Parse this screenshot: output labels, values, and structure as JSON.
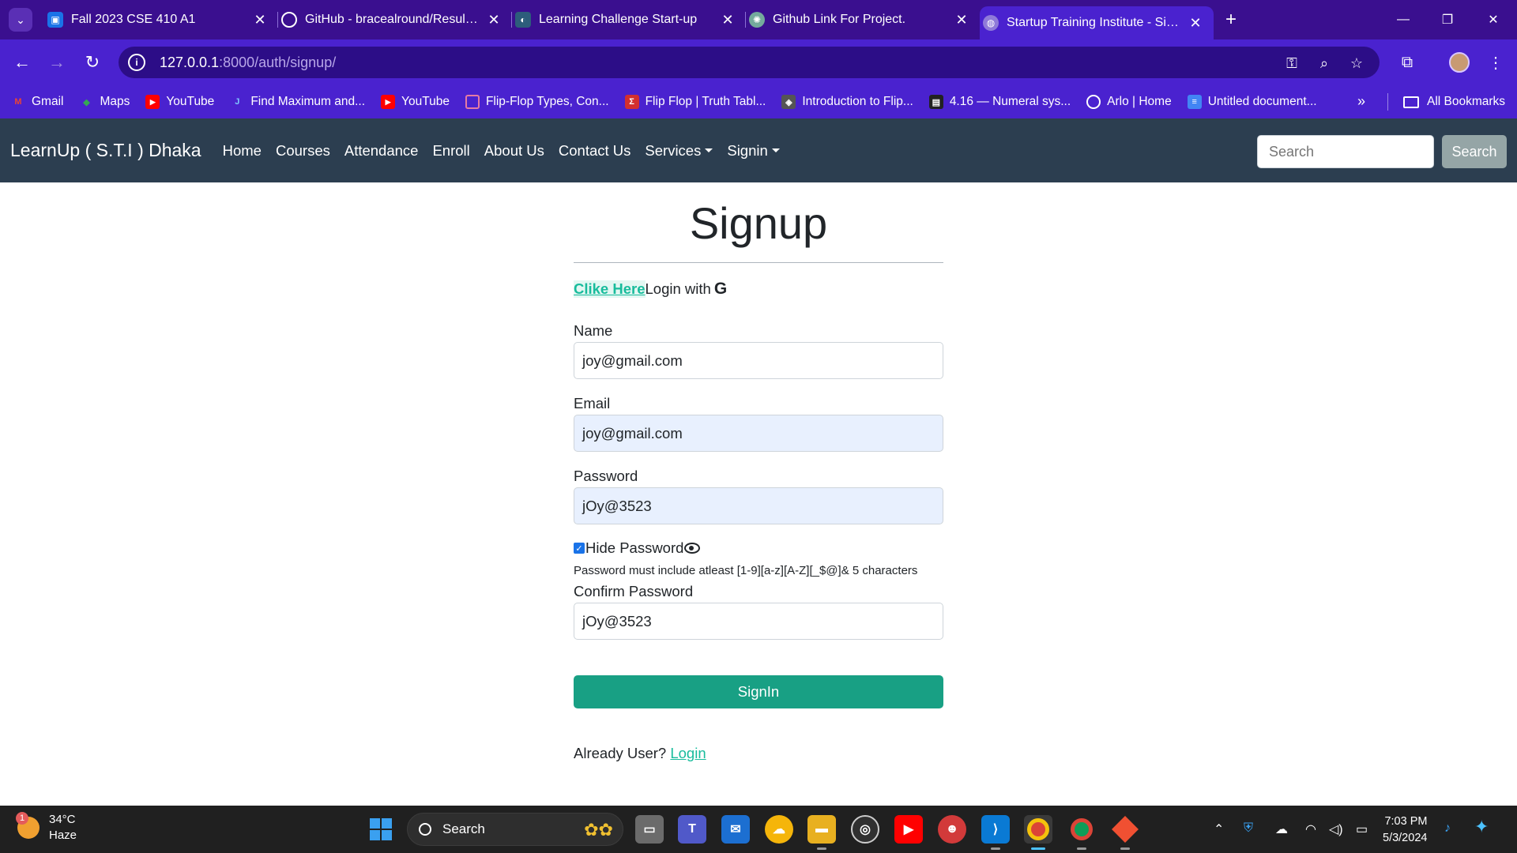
{
  "browser": {
    "tabs": [
      {
        "title": "Fall 2023 CSE 410 A1",
        "icon": "classroom-icon",
        "color": "#1a73e8"
      },
      {
        "title": "GitHub - bracealround/Result_P",
        "icon": "github-icon",
        "color": "#ffffff"
      },
      {
        "title": "Learning Challenge Start-up",
        "icon": "lc-icon",
        "color": "#2d5d7b"
      },
      {
        "title": "Github Link For Project.",
        "icon": "chatgpt-icon",
        "color": "#74aa9c"
      },
      {
        "title": "Startup Training Institute - Signup",
        "icon": "globe-icon",
        "color": "#8f7ad9",
        "active": true
      }
    ],
    "url_host": "127.0.0.1",
    "url_path": ":8000/auth/signup/",
    "bookmarks": [
      {
        "label": "Gmail",
        "icon": "gmail-icon",
        "color": "#ea4335",
        "glyph": "M"
      },
      {
        "label": "Maps",
        "icon": "maps-icon",
        "color": "#34a853",
        "glyph": "◆"
      },
      {
        "label": "YouTube",
        "icon": "youtube-icon",
        "color": "#ff0000",
        "glyph": "▶"
      },
      {
        "label": "Find Maximum and...",
        "icon": "j-icon",
        "color": "#4a22cf",
        "glyph": "J"
      },
      {
        "label": "YouTube",
        "icon": "youtube-icon",
        "color": "#ff0000",
        "glyph": "▶"
      },
      {
        "label": "Flip-Flop Types, Con...",
        "icon": "shield-icon",
        "color": "#c2185b",
        "glyph": "◊"
      },
      {
        "label": "Flip Flop | Truth Tabl...",
        "icon": "sigma-icon",
        "color": "#d32f2f",
        "glyph": "Σ"
      },
      {
        "label": "Introduction to Flip...",
        "icon": "shield-icon",
        "color": "#555555",
        "glyph": "◈"
      },
      {
        "label": "4.16 — Numeral sys...",
        "icon": "book-icon",
        "color": "#333333",
        "glyph": "▤"
      },
      {
        "label": "Arlo | Home",
        "icon": "globe-icon",
        "color": "#4a22cf",
        "glyph": "◍"
      },
      {
        "label": "Untitled document...",
        "icon": "docs-icon",
        "color": "#4285f4",
        "glyph": "≡"
      }
    ],
    "all_bookmarks": "All Bookmarks"
  },
  "site": {
    "brand": "LearnUp ( S.T.I ) Dhaka",
    "nav": [
      "Home",
      "Courses",
      "Attendance",
      "Enroll",
      "About Us",
      "Contact Us"
    ],
    "services": "Services",
    "signin": "Signin",
    "search_placeholder": "Search",
    "search_button": "Search"
  },
  "form": {
    "title": "Signup",
    "google_link": "Clike Here",
    "google_text": "Login with",
    "google_glyph": "G",
    "name_label": "Name",
    "name_value": "joy@gmail.com",
    "email_label": "Email",
    "email_value": "joy@gmail.com",
    "password_label": "Password",
    "password_value": "jOy@3523",
    "hide_password_label": "Hide Password",
    "hide_password_checked": true,
    "password_hint": "Password must include atleast [1-9][a-z][A-Z][_$@]& 5 characters",
    "confirm_label": "Confirm Password",
    "confirm_value": "jOy@3523",
    "submit": "SignIn",
    "already_text": "Already User?",
    "login_link": "Login"
  },
  "taskbar": {
    "badge": "1",
    "temperature": "34°C",
    "condition": "Haze",
    "search": "Search",
    "time": "7:03 PM",
    "date": "5/3/2024"
  }
}
